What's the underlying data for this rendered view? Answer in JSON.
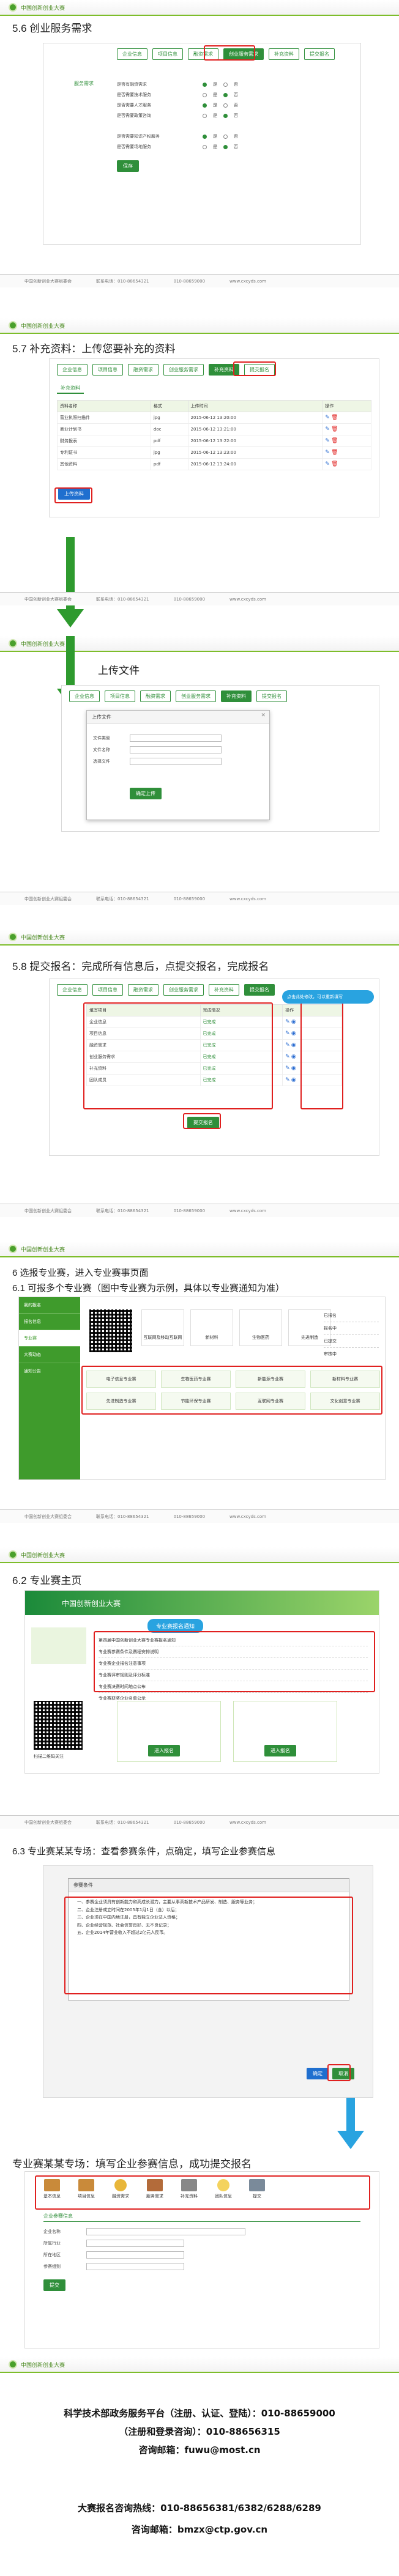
{
  "brand": {
    "header_text": "中国创新创业大赛"
  },
  "footer": {
    "items": [
      "中国创新创业大赛组委会",
      "联系电话：010-88654321",
      "010-88659000",
      "www.cxcyds.com"
    ]
  },
  "slide1": {
    "title": "5.6 创业服务需求",
    "tabs": [
      "企业信息",
      "项目信息",
      "融资需求",
      "创业服务需求",
      "补充资料",
      "提交报名"
    ],
    "active_tab": "创业服务需求",
    "section_label": "服务需求",
    "rows": [
      {
        "label": "是否有融资需求",
        "options": [
          "是",
          "否"
        ]
      },
      {
        "label": "是否需要技术服务",
        "options": [
          "是",
          "否"
        ]
      },
      {
        "label": "是否需要人才服务",
        "options": [
          "是",
          "否"
        ]
      },
      {
        "label": "是否需要政策咨询",
        "options": [
          "是",
          "否"
        ]
      },
      {
        "label": "是否需要知识产权服务",
        "options": [
          "是",
          "否"
        ]
      },
      {
        "label": "是否需要场地服务",
        "options": [
          "是",
          "否"
        ]
      }
    ],
    "save": "保存"
  },
  "slide2": {
    "title": "5.7 补充资料：上传您要补充的资料",
    "tabs": [
      "企业信息",
      "项目信息",
      "融资需求",
      "创业服务需求",
      "补充资料",
      "提交报名"
    ],
    "active_tab": "补充资料",
    "subtab": "补充资料",
    "columns": [
      "资料名称",
      "格式",
      "上传时间",
      "操作"
    ],
    "rows": [
      [
        "营业执照扫描件",
        "jpg",
        "2015-06-12 13:20:00"
      ],
      [
        "商业计划书",
        "doc",
        "2015-06-12 13:21:00"
      ],
      [
        "财务报表",
        "pdf",
        "2015-06-12 13:22:00"
      ],
      [
        "专利证书",
        "jpg",
        "2015-06-12 13:23:00"
      ],
      [
        "其他资料",
        "pdf",
        "2015-06-12 13:24:00"
      ]
    ],
    "upload_btn": "上传资料"
  },
  "slide3": {
    "title": "上传文件",
    "tabs": [
      "企业信息",
      "项目信息",
      "融资需求",
      "创业服务需求",
      "补充资料",
      "提交报名"
    ],
    "dialog_title": "上传文件",
    "fields": [
      "文件类型",
      "文件名称",
      "选择文件"
    ],
    "confirm": "确定上传"
  },
  "slide4": {
    "title": "5.8 提交报名：完成所有信息后，点提交报名，完成报名",
    "tabs": [
      "企业信息",
      "项目信息",
      "融资需求",
      "创业服务需求",
      "补充资料",
      "提交报名"
    ],
    "columns": [
      "填写项目",
      "完成情况",
      "操作"
    ],
    "rows": [
      [
        "企业信息",
        "已完成"
      ],
      [
        "项目信息",
        "已完成"
      ],
      [
        "融资需求",
        "已完成"
      ],
      [
        "创业服务需求",
        "已完成"
      ],
      [
        "补充资料",
        "已完成"
      ],
      [
        "团队成员",
        "已完成"
      ]
    ],
    "callout": "点击此处修改，可以重新填写",
    "submit": "提交报名"
  },
  "slide5": {
    "title_a": "6 选报专业赛，进入专业赛事页面",
    "title_b": "6.1 可报多个专业赛（图中专业赛为示例，具体以专业赛通知为准）",
    "side_items": [
      "我的报名",
      "报名信息",
      "专业赛",
      "大赛动态",
      "通知公告"
    ],
    "cards": [
      "互联网及移动互联网",
      "新材料",
      "生物医药",
      "先进制造"
    ],
    "pro_btns": [
      "电子信息专业赛",
      "生物医药专业赛",
      "新能源专业赛",
      "新材料专业赛",
      "先进制造专业赛",
      "节能环保专业赛",
      "互联网专业赛",
      "文化创意专业赛"
    ],
    "right_list": [
      "已报名",
      "报名中",
      "已提交",
      "审核中"
    ]
  },
  "slide6": {
    "title": "6.2 专业赛主页",
    "banner": "中国创新创业大赛",
    "notice_label": "专业赛报名通知",
    "list": [
      "第四届中国创新创业大赛专业赛报名通知",
      "专业赛参赛条件及赛程安排说明",
      "专业赛企业报名注意事项",
      "专业赛评审规则及评分标准",
      "专业赛决赛时间地点公布",
      "专业赛获奖企业名单公示"
    ],
    "qr_caption": "扫描二维码关注",
    "enter_btns": [
      "进入报名",
      "进入报名"
    ]
  },
  "slide7": {
    "title": "6.3 专业赛某某专场：查看参赛条件，点确定，填写企业参赛信息",
    "dialog_title": "参赛条件",
    "lines": [
      "一、参赛企业须具有创新能力和高成长潜力，主要从事高新技术产品研发、制造、服务等业务；",
      "二、企业注册成立时间在2005年1月1日（含）以后；",
      "三、企业须在中国内地注册，具有独立企业法人资格；",
      "四、企业经营规范、社会信誉良好、无不良记录；",
      "五、企业2014年营业收入不超过2亿元人民币。"
    ],
    "ok": "确定",
    "cancel": "取消"
  },
  "slide8": {
    "title": "专业赛某某专场：填写企业参赛信息，成功提交报名",
    "steps": [
      "基本信息",
      "项目信息",
      "融资需求",
      "服务需求",
      "补充资料",
      "团队信息",
      "提交"
    ],
    "form_title": "企业参赛信息",
    "fields": [
      "企业名称",
      "所属行业",
      "所在地区",
      "参赛组别"
    ],
    "submit": "提交"
  },
  "contact": {
    "line1": "科学技术部政务服务平台（注册、认证、登陆）：010-88659000",
    "line2": "（注册和登录咨询）：010-88656315",
    "line3": "咨询邮箱：fuwu@most.cn",
    "line4": "大赛报名咨询热线：010-88656381/6382/6288/6289",
    "line5": "咨询邮箱：bmzx@ctp.gov.cn"
  }
}
